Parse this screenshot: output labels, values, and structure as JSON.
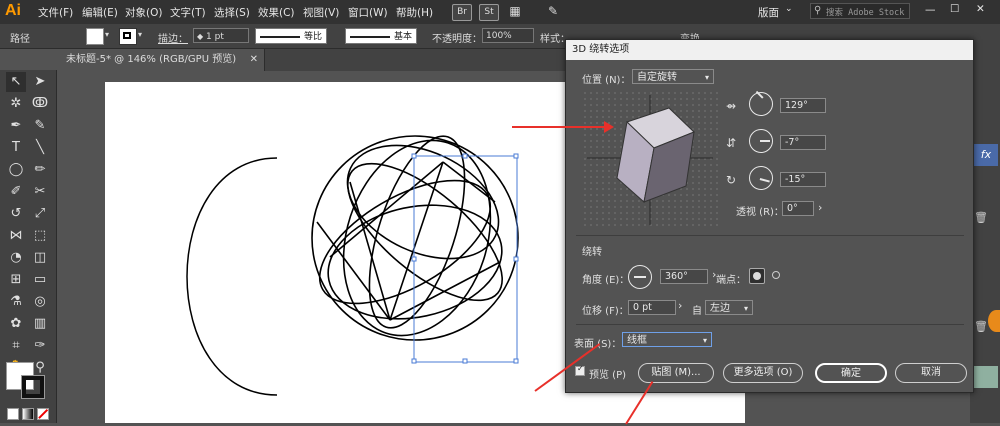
{
  "app": {
    "logo": "Ai"
  },
  "menu": [
    "文件(F)",
    "编辑(E)",
    "对象(O)",
    "文字(T)",
    "选择(S)",
    "效果(C)",
    "视图(V)",
    "窗口(W)",
    "帮助(H)"
  ],
  "topbar": {
    "br_label": "Br",
    "st_label": "St",
    "workspace": "版面",
    "search_placeholder": "搜索 Adobe Stock"
  },
  "control": {
    "object_type": "路径",
    "stroke_label": "描边：",
    "stroke_weight": "1 pt",
    "profile_uniform": "等比",
    "brush_basic": "基本",
    "opacity_label": "不透明度：",
    "opacity_value": "100%",
    "style_label": "样式：",
    "transform_label": "变换"
  },
  "document": {
    "tab_title": "未标题-5* @ 146% (RGB/GPU 预览)"
  },
  "dialog": {
    "title": "3D 绕转选项",
    "position_label": "位置 (N)：",
    "position_value": "自定旋转",
    "rot_x": "129°",
    "rot_y": "-7°",
    "rot_z": "-15°",
    "perspective_label": "透视 (R)：",
    "perspective_value": "0°",
    "revolve_section": "绕转",
    "angle_label": "角度 (E)：",
    "angle_value": "360°",
    "cap_label": "端点：",
    "offset_label": "位移 (F)：",
    "offset_value": "0 pt",
    "from_label": "自",
    "from_value": "左边",
    "surface_label": "表面 (S)：",
    "surface_value": "线框",
    "preview_label": "预览 (P)",
    "map_button": "贴图 (M)...",
    "more_button": "更多选项 (O)",
    "ok_button": "确定",
    "cancel_button": "取消"
  },
  "colors": {
    "accent_arrow": "#e8302a",
    "fx_panel": "#4a6aa8"
  }
}
